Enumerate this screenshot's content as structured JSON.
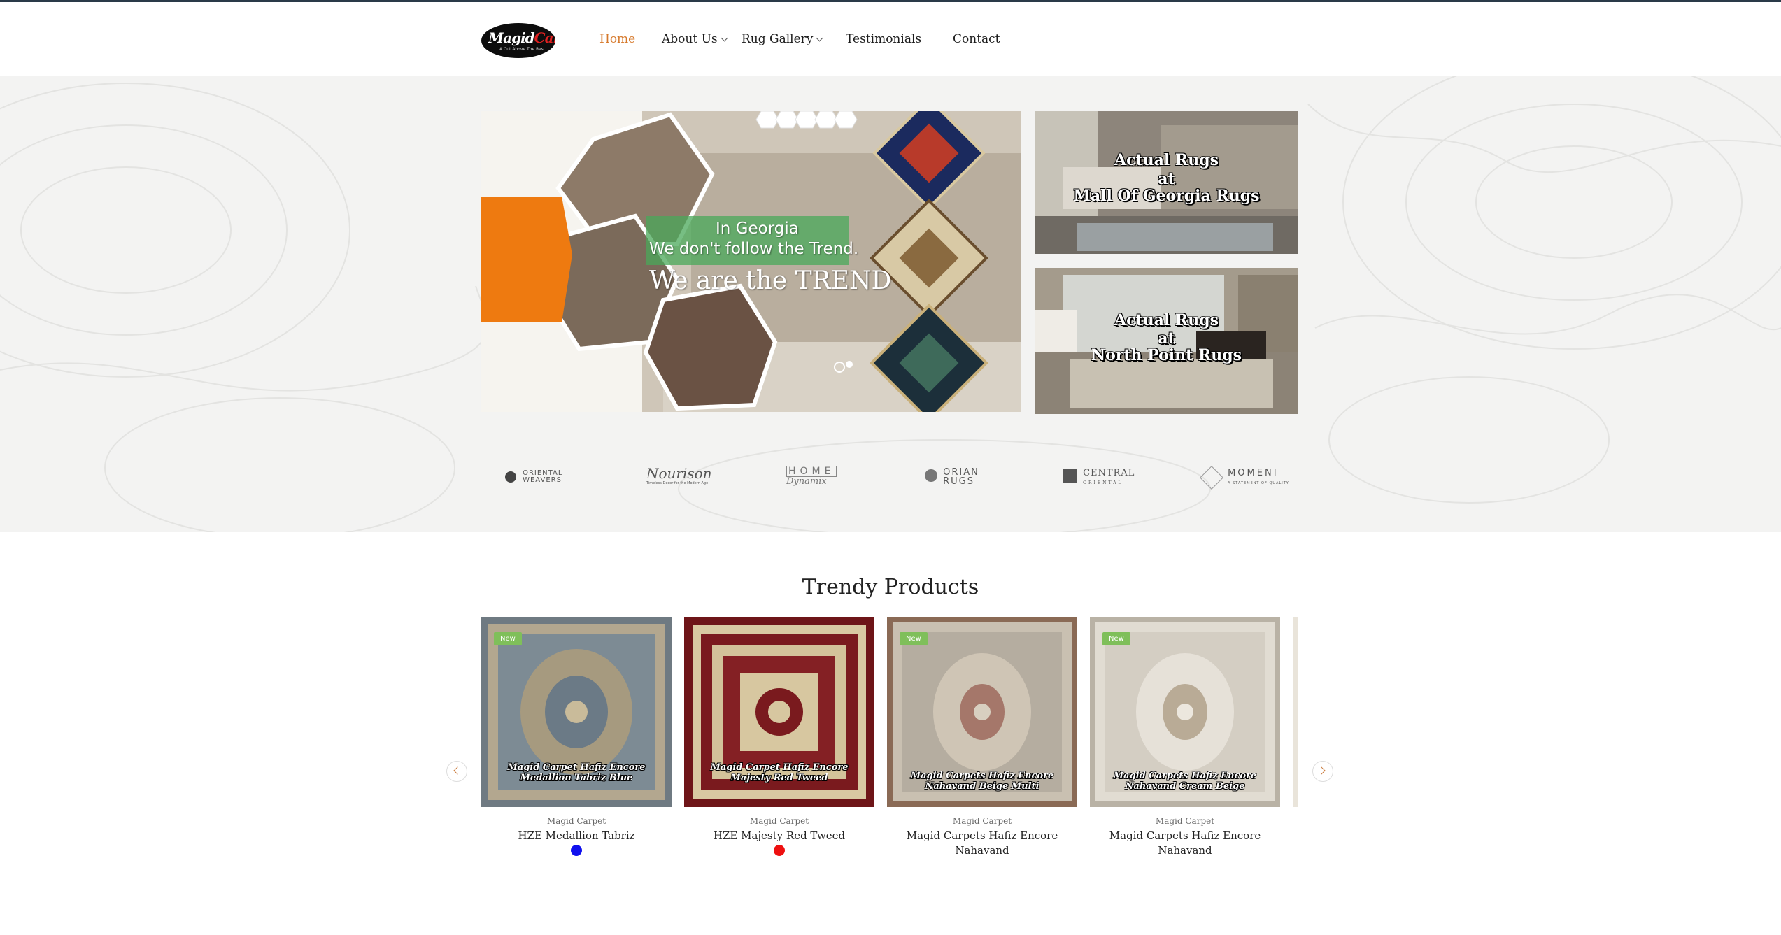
{
  "logo": {
    "part1": "Magid",
    "part2": "Carpets",
    "tagline": "A Cut Above The Rest"
  },
  "nav": [
    {
      "label": "Home",
      "active": true
    },
    {
      "label": "About Us",
      "dropdown": true
    },
    {
      "label": "Rug Gallery",
      "dropdown": true
    },
    {
      "label": "Testimonials"
    },
    {
      "label": "Contact"
    }
  ],
  "banner": {
    "line1": "In Georgia",
    "line2": "We don't follow the Trend.",
    "line3": "We are the TREND"
  },
  "side_cards": [
    {
      "line1": "Actual Rugs",
      "line2": "at",
      "line3": "Mall Of Georgia Rugs"
    },
    {
      "line1": "Actual Rugs",
      "line2": "at",
      "line3": "North Point Rugs"
    }
  ],
  "brands": [
    {
      "name": "ORIENTAL",
      "sub": "WEAVERS",
      "icon": "oriental-weavers-logo"
    },
    {
      "name": "Nourison",
      "sub": "Timeless Decor for the Modern Age",
      "icon": "nourison-logo"
    },
    {
      "name": "HOME",
      "sub": "Dynamix",
      "icon": "home-dynamix-logo"
    },
    {
      "name": "ORIAN",
      "sub": "RUGS",
      "icon": "orian-rugs-logo"
    },
    {
      "name": "CENTRAL",
      "sub": "ORIENTAL",
      "icon": "central-oriental-logo"
    },
    {
      "name": "MOMENI",
      "sub": "A STATEMENT OF QUALITY",
      "icon": "momeni-logo"
    }
  ],
  "products_section": {
    "title": "Trendy Products",
    "items": [
      {
        "badge": "New",
        "brand": "Magid Carpet",
        "name": "HZE Medallion Tabriz",
        "overlay1": "Magid Carpet Hafiz Encore",
        "overlay2": "Medallion Tabriz Blue",
        "swatch": "#1010ee"
      },
      {
        "badge": "",
        "brand": "Magid Carpet",
        "name": "HZE Majesty Red Tweed",
        "overlay1": "Magid Carpet Hafiz Encore",
        "overlay2": "Majesty Red Tweed",
        "swatch": "#ee1010"
      },
      {
        "badge": "New",
        "brand": "Magid Carpet",
        "name": "Magid Carpets Hafiz Encore Nahavand",
        "overlay1": "Magid Carpets Hafiz Encore",
        "overlay2": "Nahavand Beige Multi",
        "swatch": ""
      },
      {
        "badge": "New",
        "brand": "Magid Carpet",
        "name": "Magid Carpets Hafiz Encore Nahavand",
        "overlay1": "Magid Carpets Hafiz Encore",
        "overlay2": "Nahavand Cream Beige",
        "swatch": ""
      }
    ]
  },
  "colors": {
    "accent": "#d6782a",
    "badge": "#7fbf5a",
    "orange": "#ee7a10"
  }
}
